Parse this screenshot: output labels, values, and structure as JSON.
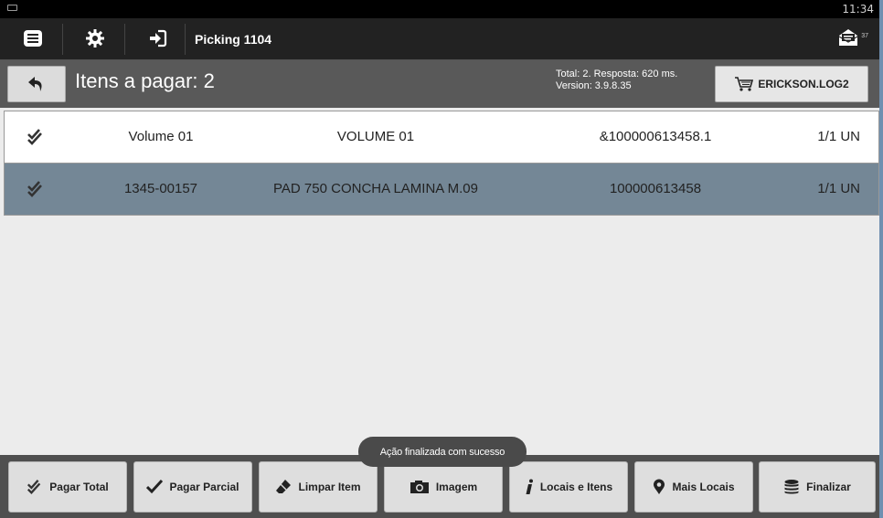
{
  "statusbar": {
    "time": "11:34"
  },
  "actionbar": {
    "title": "Picking 1104",
    "mail_count": "37"
  },
  "header": {
    "title": "Itens a pagar: 2",
    "stats_line1": "Total: 2. Resposta: 620 ms.",
    "stats_line2": "Version: 3.9.8.35",
    "user": "ERICKSON.LOG2"
  },
  "rows": [
    {
      "code": "Volume 01",
      "description": "VOLUME 01",
      "reference": "&100000613458.1",
      "quantity": "1/1 UN"
    },
    {
      "code": "1345-00157",
      "description": "PAD 750 CONCHA LAMINA M.09",
      "reference": "100000613458",
      "quantity": "1/1 UN"
    }
  ],
  "toast": "Ação finalizada com sucesso",
  "buttons": {
    "pagar_total": "Pagar Total",
    "pagar_parcial": "Pagar Parcial",
    "limpar_item": "Limpar Item",
    "imagem": "Imagem",
    "locais_itens": "Locais e Itens",
    "mais_locais": "Mais Locais",
    "finalizar": "Finalizar"
  },
  "colors": {
    "selected_row": "#748796",
    "header_bg": "#595959",
    "actionbar_bg": "#222222"
  }
}
